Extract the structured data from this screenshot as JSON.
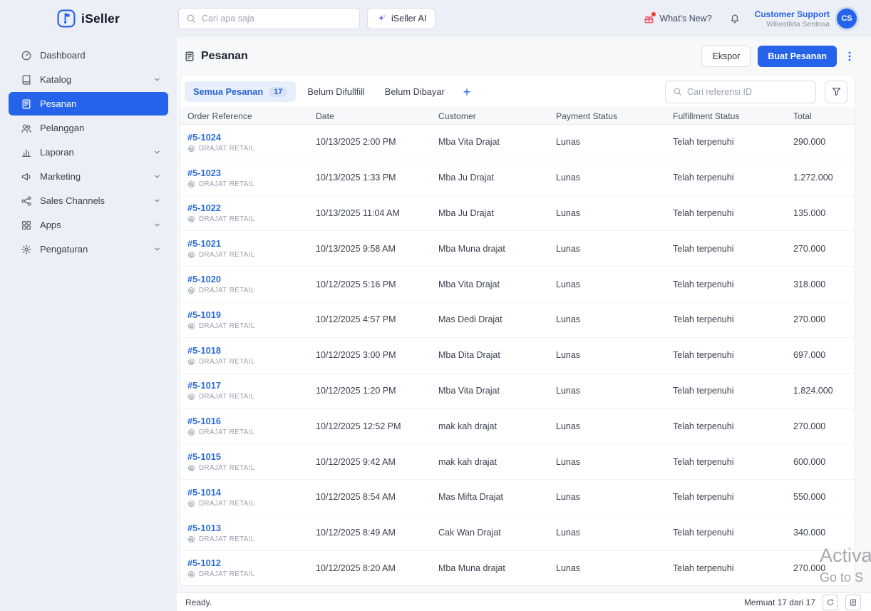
{
  "accent": "#2563eb",
  "brand": {
    "name": "iSeller"
  },
  "header": {
    "search": {
      "placeholder": "Cari apa saja"
    },
    "ai_button": "iSeller AI",
    "whats_new": "What's New?",
    "user": {
      "name": "Customer Support",
      "org": "Wilwatikta Sentosa",
      "initials": "CS"
    }
  },
  "sidebar": {
    "items": [
      {
        "label": "Dashboard",
        "icon": "dashboard-icon",
        "chevron": false,
        "active": false
      },
      {
        "label": "Katalog",
        "icon": "catalog-icon",
        "chevron": true,
        "active": false
      },
      {
        "label": "Pesanan",
        "icon": "orders-icon",
        "chevron": false,
        "active": true
      },
      {
        "label": "Pelanggan",
        "icon": "customers-icon",
        "chevron": false,
        "active": false
      },
      {
        "label": "Laporan",
        "icon": "reports-icon",
        "chevron": true,
        "active": false
      },
      {
        "label": "Marketing",
        "icon": "marketing-icon",
        "chevron": true,
        "active": false
      },
      {
        "label": "Sales Channels",
        "icon": "channels-icon",
        "chevron": true,
        "active": false
      },
      {
        "label": "Apps",
        "icon": "apps-icon",
        "chevron": true,
        "active": false
      },
      {
        "label": "Pengaturan",
        "icon": "settings-icon",
        "chevron": true,
        "active": false
      }
    ]
  },
  "page": {
    "title": "Pesanan",
    "export_label": "Ekspor",
    "create_label": "Buat Pesanan"
  },
  "toolbar": {
    "tabs": [
      {
        "label": "Semua Pesanan",
        "badge": "17",
        "active": true
      },
      {
        "label": "Belum Difullfill",
        "active": false
      },
      {
        "label": "Belum Dibayar",
        "active": false
      }
    ],
    "add_tab": "+",
    "search_placeholder": "Cari referensi ID"
  },
  "table": {
    "columns": [
      "Order Reference",
      "Date",
      "Customer",
      "Payment Status",
      "Fulfillment Status",
      "Total"
    ],
    "rows": [
      {
        "ref": "#5-1024",
        "store": "DRAJAT RETAIL",
        "date": "10/13/2025 2:00 PM",
        "customer": "Mba Vita Drajat",
        "payment": "Lunas",
        "fulfillment": "Telah terpenuhi",
        "total": "290.000"
      },
      {
        "ref": "#5-1023",
        "store": "DRAJAT RETAIL",
        "date": "10/13/2025 1:33 PM",
        "customer": "Mba Ju Drajat",
        "payment": "Lunas",
        "fulfillment": "Telah terpenuhi",
        "total": "1.272.000"
      },
      {
        "ref": "#5-1022",
        "store": "DRAJAT RETAIL",
        "date": "10/13/2025 11:04 AM",
        "customer": "Mba Ju Drajat",
        "payment": "Lunas",
        "fulfillment": "Telah terpenuhi",
        "total": "135.000"
      },
      {
        "ref": "#5-1021",
        "store": "DRAJAT RETAIL",
        "date": "10/13/2025 9:58 AM",
        "customer": "Mba Muna drajat",
        "payment": "Lunas",
        "fulfillment": "Telah terpenuhi",
        "total": "270.000"
      },
      {
        "ref": "#5-1020",
        "store": "DRAJAT RETAIL",
        "date": "10/12/2025 5:16 PM",
        "customer": "Mba Vita Drajat",
        "payment": "Lunas",
        "fulfillment": "Telah terpenuhi",
        "total": "318.000"
      },
      {
        "ref": "#5-1019",
        "store": "DRAJAT RETAIL",
        "date": "10/12/2025 4:57 PM",
        "customer": "Mas Dedi Drajat",
        "payment": "Lunas",
        "fulfillment": "Telah terpenuhi",
        "total": "270.000"
      },
      {
        "ref": "#5-1018",
        "store": "DRAJAT RETAIL",
        "date": "10/12/2025 3:00 PM",
        "customer": "Mba Dita Drajat",
        "payment": "Lunas",
        "fulfillment": "Telah terpenuhi",
        "total": "697.000"
      },
      {
        "ref": "#5-1017",
        "store": "DRAJAT RETAIL",
        "date": "10/12/2025 1:20 PM",
        "customer": "Mba Vita Drajat",
        "payment": "Lunas",
        "fulfillment": "Telah terpenuhi",
        "total": "1.824.000"
      },
      {
        "ref": "#5-1016",
        "store": "DRAJAT RETAIL",
        "date": "10/12/2025 12:52 PM",
        "customer": "mak kah drajat",
        "payment": "Lunas",
        "fulfillment": "Telah terpenuhi",
        "total": "270.000"
      },
      {
        "ref": "#5-1015",
        "store": "DRAJAT RETAIL",
        "date": "10/12/2025 9:42 AM",
        "customer": "mak kah drajat",
        "payment": "Lunas",
        "fulfillment": "Telah terpenuhi",
        "total": "600.000"
      },
      {
        "ref": "#5-1014",
        "store": "DRAJAT RETAIL",
        "date": "10/12/2025 8:54 AM",
        "customer": "Mas Mifta Drajat",
        "payment": "Lunas",
        "fulfillment": "Telah terpenuhi",
        "total": "550.000"
      },
      {
        "ref": "#5-1013",
        "store": "DRAJAT RETAIL",
        "date": "10/12/2025 8:49 AM",
        "customer": "Cak Wan Drajat",
        "payment": "Lunas",
        "fulfillment": "Telah terpenuhi",
        "total": "340.000"
      },
      {
        "ref": "#5-1012",
        "store": "DRAJAT RETAIL",
        "date": "10/12/2025 8:20 AM",
        "customer": "Mba Muna drajat",
        "payment": "Lunas",
        "fulfillment": "Telah terpenuhi",
        "total": "270.000"
      }
    ]
  },
  "statusbar": {
    "ready": "Ready.",
    "count": "Memuat 17 dari 17"
  },
  "watermark": {
    "line1": "Activa",
    "line2": "Go to S"
  }
}
